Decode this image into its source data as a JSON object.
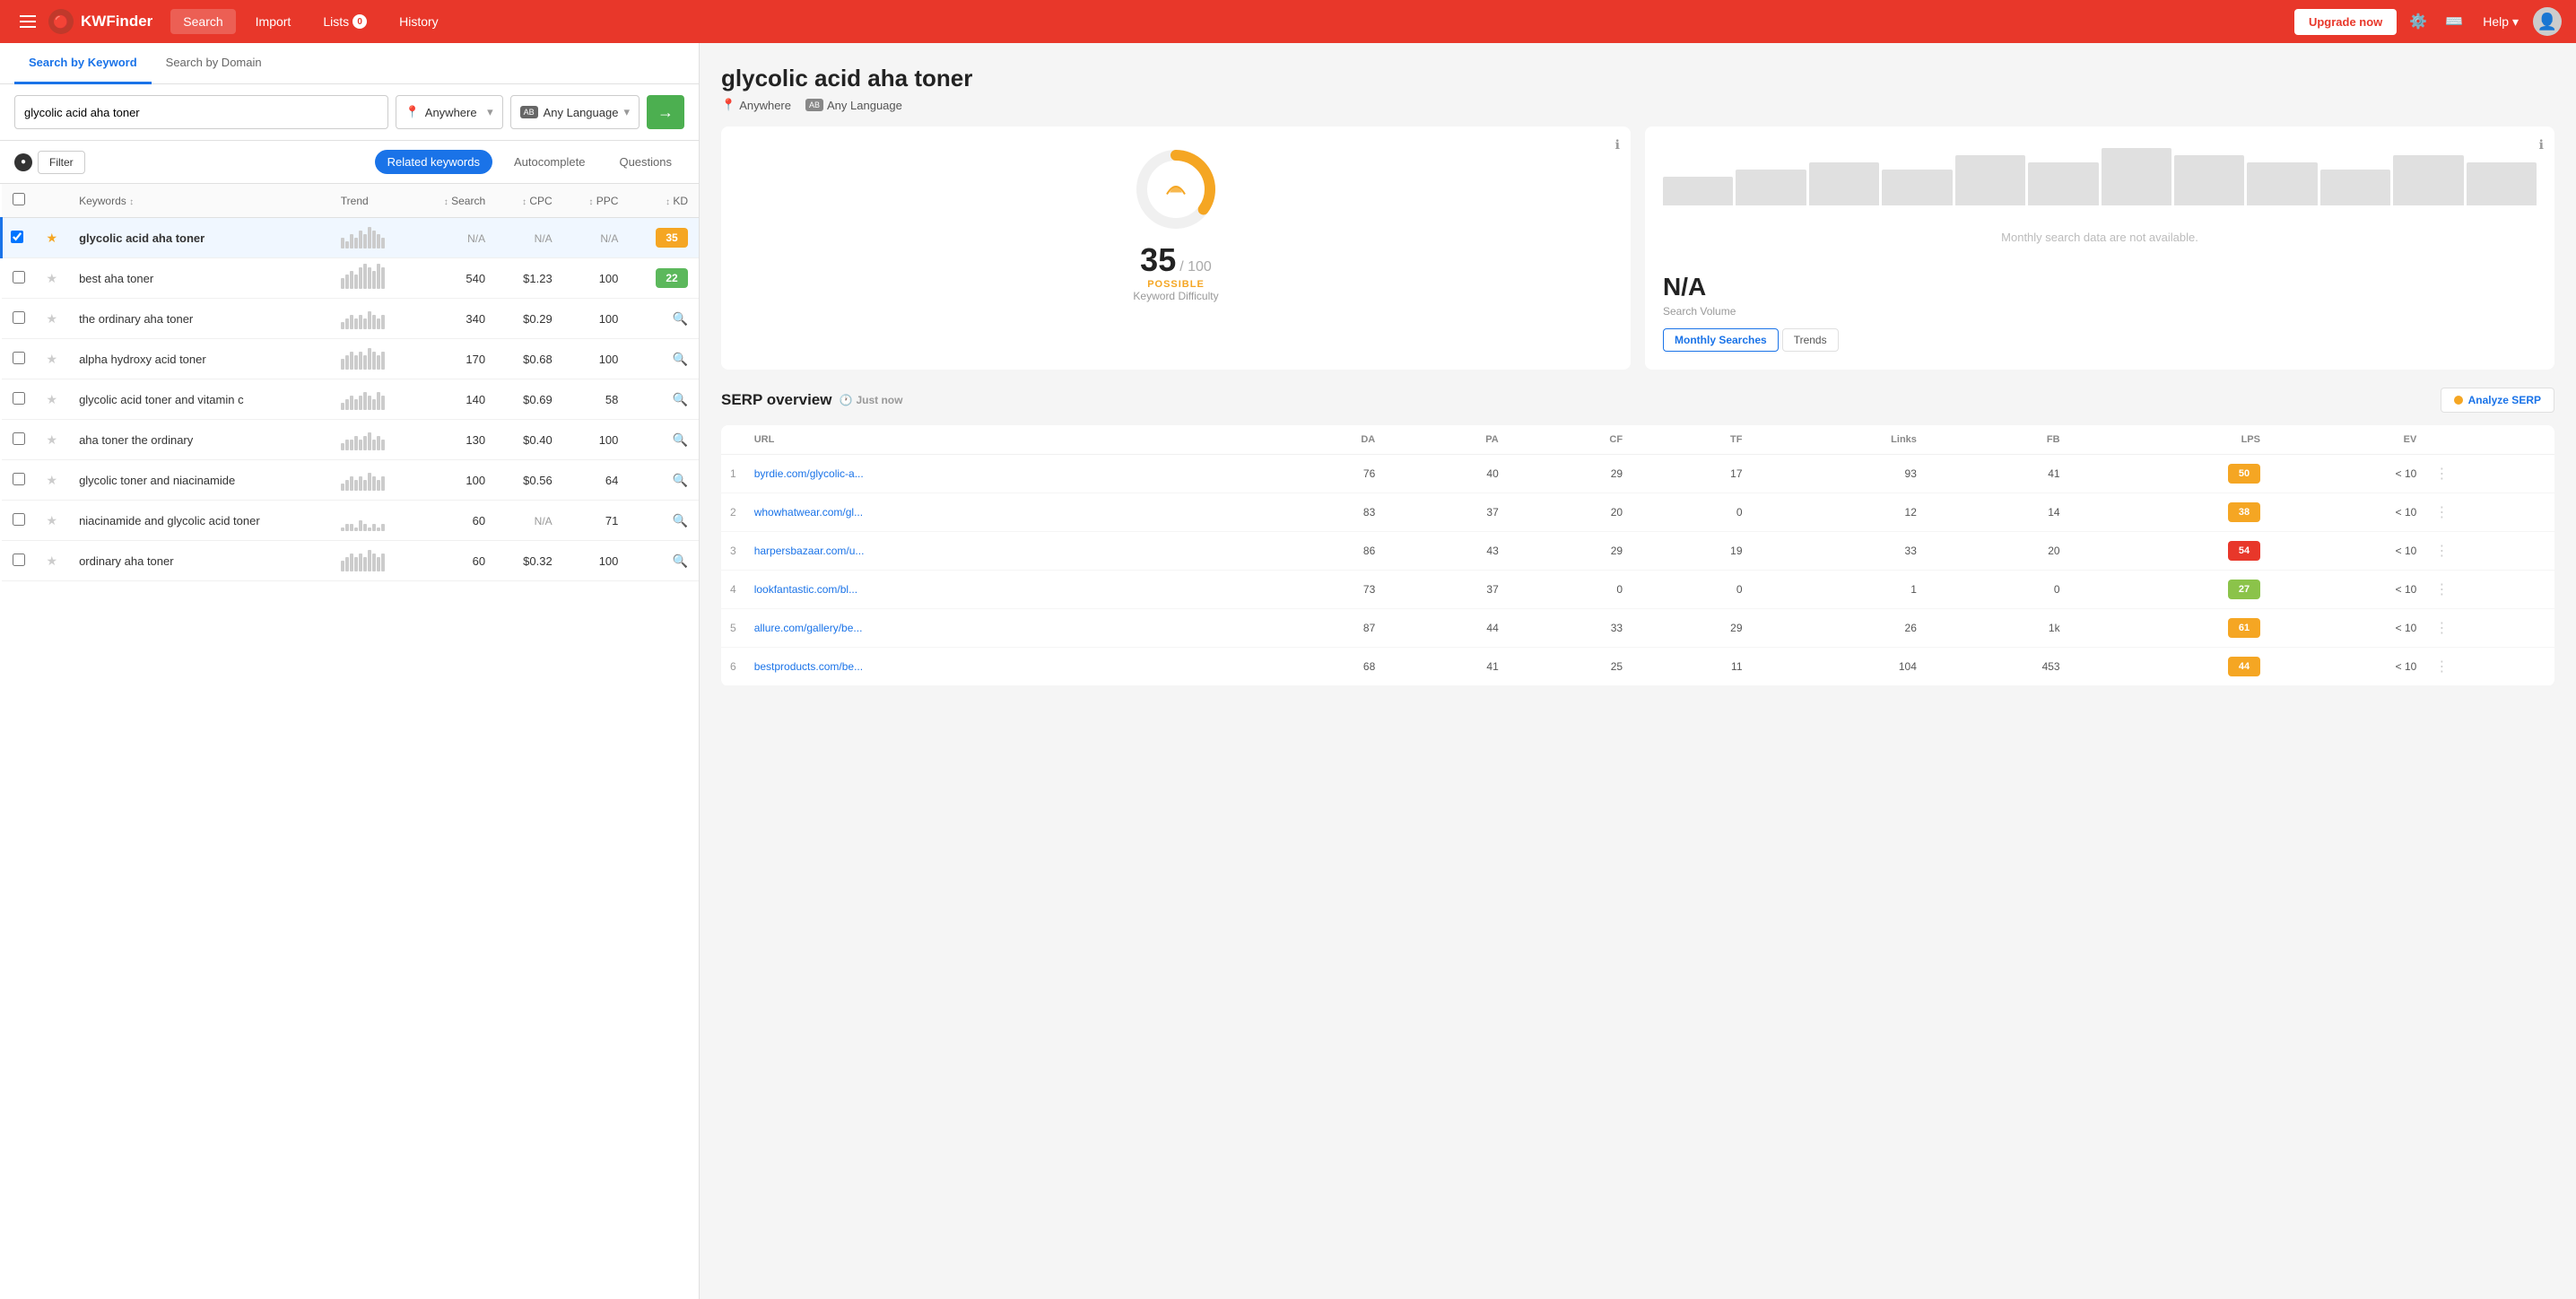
{
  "app": {
    "name": "KWFinder",
    "logo": "🔴"
  },
  "topnav": {
    "menu_label": "☰",
    "items": [
      {
        "id": "search",
        "label": "Search",
        "active": true
      },
      {
        "id": "import",
        "label": "Import",
        "active": false
      },
      {
        "id": "lists",
        "label": "Lists",
        "badge": "0",
        "active": false
      },
      {
        "id": "history",
        "label": "History",
        "active": false
      }
    ],
    "upgrade_label": "Upgrade now",
    "help_label": "Help",
    "avatar": "👤"
  },
  "left_panel": {
    "tabs": [
      {
        "id": "keyword",
        "label": "Search by Keyword",
        "active": true
      },
      {
        "id": "domain",
        "label": "Search by Domain",
        "active": false
      }
    ],
    "search": {
      "value": "glycolic acid aha toner",
      "location": "Anywhere",
      "language": "Any Language",
      "location_icon": "📍",
      "language_icon": "AB",
      "button_icon": "→"
    },
    "filter": {
      "label": "Filter",
      "tabs": [
        {
          "id": "related",
          "label": "Related keywords",
          "active": true
        },
        {
          "id": "autocomplete",
          "label": "Autocomplete",
          "active": false
        },
        {
          "id": "questions",
          "label": "Questions",
          "active": false
        }
      ]
    },
    "table": {
      "columns": [
        "",
        "",
        "Keywords",
        "Trend",
        "Search",
        "CPC",
        "PPC",
        "KD"
      ],
      "rows": [
        {
          "active": true,
          "keyword": "glycolic acid aha toner",
          "trend": [
            3,
            2,
            4,
            3,
            5,
            4,
            6,
            5,
            4,
            3
          ],
          "search": "N/A",
          "cpc": "N/A",
          "ppc": "N/A",
          "kd": 35,
          "kd_color": "orange"
        },
        {
          "active": false,
          "keyword": "best aha toner",
          "trend": [
            3,
            4,
            5,
            4,
            6,
            7,
            6,
            5,
            7,
            6
          ],
          "search": "540",
          "cpc": "$1.23",
          "ppc": "100",
          "kd": 22,
          "kd_color": "green"
        },
        {
          "active": false,
          "keyword": "the ordinary aha toner",
          "trend": [
            2,
            3,
            4,
            3,
            4,
            3,
            5,
            4,
            3,
            4
          ],
          "search": "340",
          "cpc": "$0.29",
          "ppc": "100",
          "kd": null,
          "kd_color": "na"
        },
        {
          "active": false,
          "keyword": "alpha hydroxy acid toner",
          "trend": [
            3,
            4,
            5,
            4,
            5,
            4,
            6,
            5,
            4,
            5
          ],
          "search": "170",
          "cpc": "$0.68",
          "ppc": "100",
          "kd": null,
          "kd_color": "na"
        },
        {
          "active": false,
          "keyword": "glycolic acid toner and vitamin c",
          "trend": [
            2,
            3,
            4,
            3,
            4,
            5,
            4,
            3,
            5,
            4
          ],
          "search": "140",
          "cpc": "$0.69",
          "ppc": "58",
          "kd": null,
          "kd_color": "na"
        },
        {
          "active": false,
          "keyword": "aha toner the ordinary",
          "trend": [
            2,
            3,
            3,
            4,
            3,
            4,
            5,
            3,
            4,
            3
          ],
          "search": "130",
          "cpc": "$0.40",
          "ppc": "100",
          "kd": null,
          "kd_color": "na"
        },
        {
          "active": false,
          "keyword": "glycolic toner and niacinamide",
          "trend": [
            2,
            3,
            4,
            3,
            4,
            3,
            5,
            4,
            3,
            4
          ],
          "search": "100",
          "cpc": "$0.56",
          "ppc": "64",
          "kd": null,
          "kd_color": "na"
        },
        {
          "active": false,
          "keyword": "niacinamide and glycolic acid toner",
          "trend": [
            1,
            2,
            2,
            1,
            3,
            2,
            1,
            2,
            1,
            2
          ],
          "search": "60",
          "cpc": "N/A",
          "ppc": "71",
          "kd": null,
          "kd_color": "na"
        },
        {
          "active": false,
          "keyword": "ordinary aha toner",
          "trend": [
            3,
            4,
            5,
            4,
            5,
            4,
            6,
            5,
            4,
            5
          ],
          "search": "60",
          "cpc": "$0.32",
          "ppc": "100",
          "kd": null,
          "kd_color": "na"
        }
      ]
    }
  },
  "right_panel": {
    "keyword": "glycolic acid aha toner",
    "location": "Anywhere",
    "language": "Any Language",
    "kd_card": {
      "value": 35,
      "max": 100,
      "label": "/ 100",
      "status": "POSSIBLE",
      "sublabel": "Keyword Difficulty"
    },
    "volume_card": {
      "value": "N/A",
      "sublabel": "Search Volume",
      "message": "Monthly search data are not available.",
      "tabs": [
        {
          "id": "monthly",
          "label": "Monthly Searches",
          "active": true
        },
        {
          "id": "trends",
          "label": "Trends",
          "active": false
        }
      ],
      "chart_bars": [
        4,
        5,
        6,
        5,
        7,
        6,
        8,
        7,
        6,
        5,
        7,
        6
      ]
    },
    "serp": {
      "title": "SERP overview",
      "time": "Just now",
      "analyze_label": "Analyze SERP",
      "columns": [
        "",
        "URL",
        "DA",
        "PA",
        "CF",
        "TF",
        "Links",
        "FB",
        "LPS",
        "EV",
        ""
      ],
      "rows": [
        {
          "rank": 1,
          "url": "byrdie.com/glycolic-a...",
          "da": 76,
          "pa": 40,
          "cf": 29,
          "tf": 17,
          "links": 93,
          "fb": 41,
          "lps": 50,
          "lps_color": "orange",
          "ev": "< 10"
        },
        {
          "rank": 2,
          "url": "whowhatwear.com/gl...",
          "da": 83,
          "pa": 37,
          "cf": 20,
          "tf": 0,
          "links": 12,
          "fb": 14,
          "lps": 38,
          "lps_color": "orange",
          "ev": "< 10"
        },
        {
          "rank": 3,
          "url": "harpersbazaar.com/u...",
          "da": 86,
          "pa": 43,
          "cf": 29,
          "tf": 19,
          "links": 33,
          "fb": 20,
          "lps": 54,
          "lps_color": "red",
          "ev": "< 10"
        },
        {
          "rank": 4,
          "url": "lookfantastic.com/bl...",
          "da": 73,
          "pa": 37,
          "cf": 0,
          "tf": 0,
          "links": 1,
          "fb": 0,
          "lps": 27,
          "lps_color": "green",
          "ev": "< 10"
        },
        {
          "rank": 5,
          "url": "allure.com/gallery/be...",
          "da": 87,
          "pa": 44,
          "cf": 33,
          "tf": 29,
          "links": 26,
          "fb": "1k",
          "lps": 61,
          "lps_color": "orange",
          "ev": "< 10"
        },
        {
          "rank": 6,
          "url": "bestproducts.com/be...",
          "da": 68,
          "pa": 41,
          "cf": 25,
          "tf": 11,
          "links": 104,
          "fb": 453,
          "lps": 44,
          "lps_color": "orange",
          "ev": "< 10"
        }
      ]
    }
  }
}
